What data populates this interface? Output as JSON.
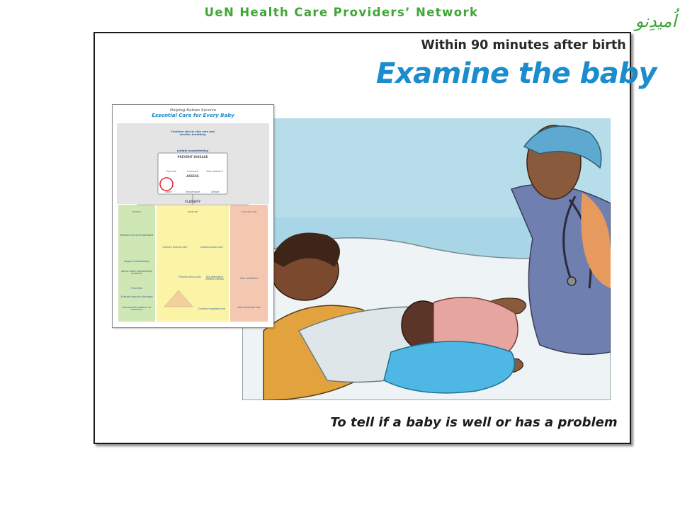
{
  "header": {
    "network_title": "UeN Health Care Providers’ Network",
    "logo_text": "اُمیدِنو"
  },
  "slide": {
    "subhead": "Within 90 minutes after birth",
    "headline": "Examine the baby",
    "caption": "To tell if a baby is well or has a problem"
  },
  "action_plan": {
    "supertitle": "Helping Babies Survive",
    "title": "Essential Care for Every Baby",
    "step_birth": "Continue skin to skin care and monitor breathing",
    "step_feeding": "Initiate breastfeeding",
    "prevent_disease": "PREVENT DISEASE",
    "prevent_items": [
      "Eye care",
      "Cord care",
      "Give vitamin K"
    ],
    "assess": "ASSESS",
    "assess_items": [
      "Exam",
      "Temperature",
      "Weight"
    ],
    "classify": "CLASSIFY",
    "column_normal": "NORMAL",
    "column_problem": "PROBLEM",
    "column_danger": "DANGER SIGN",
    "normal_items": [
      "Maintain normal temperature",
      "Support breastfeeding",
      "Advise about breastfeeding problems",
      "Protect/Go",
      "Evaluate baby for discharge",
      "Give parents guidance for home care"
    ],
    "problem_items": [
      "Improve thermal care",
      "Express breast milk",
      "Prolong skin-to-skin",
      "Use alternative feeding method",
      "Continue inpatient care"
    ],
    "danger_items": [
      "Give antibiotics",
      "Seek advanced care"
    ],
    "colors": {
      "normal": "#cfe7b4",
      "problem": "#fbf3a6",
      "danger": "#f3c7b0",
      "top": "#e4e4e4",
      "circle": "#e0202a"
    }
  }
}
